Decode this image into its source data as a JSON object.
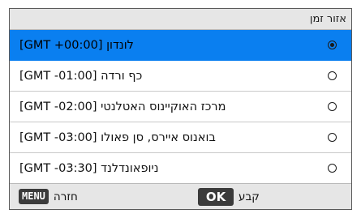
{
  "dialog": {
    "title": "אזור זמן"
  },
  "rows": [
    {
      "label": "לונדון [GMT +00:00]",
      "selected": true
    },
    {
      "label": "כף ורדה [GMT -01:00]",
      "selected": false
    },
    {
      "label": "מרכז האוקיינוס האטלנטי [GMT -02:00]",
      "selected": false
    },
    {
      "label": "בואנוס איירס, סן פאולו [GMT -03:00]",
      "selected": false
    },
    {
      "label": "ניופאונדלנד [GMT -03:30]",
      "selected": false
    }
  ],
  "footer": {
    "menu_key": "MENU",
    "back_label": "חזרה",
    "ok_key": "OK",
    "set_label": "קבע"
  },
  "colors": {
    "selected_row": "#0a7ff0",
    "bar_background": "#e6e6e6",
    "key_background": "#3b3b3b"
  }
}
